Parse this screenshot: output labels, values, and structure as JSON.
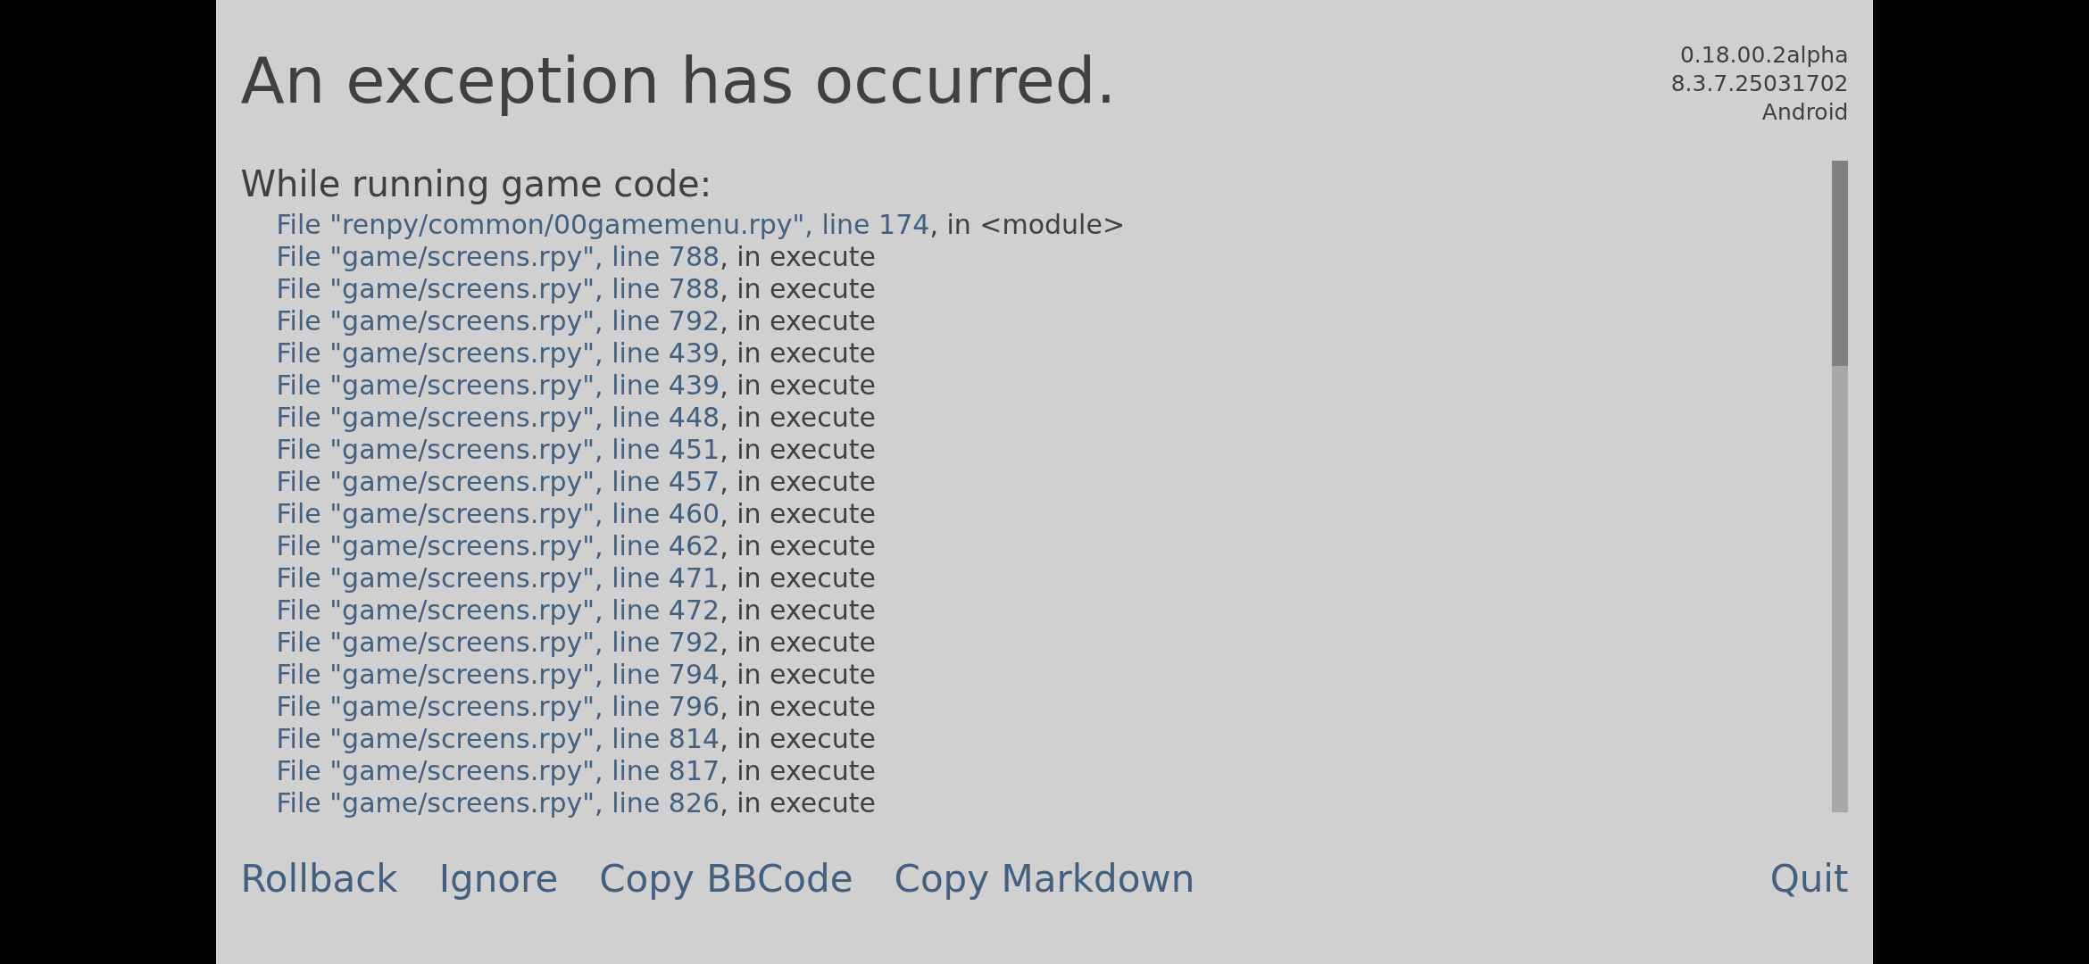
{
  "title": "An exception has occurred.",
  "version_info": [
    "0.18.00.2alpha",
    "8.3.7.25031702",
    "Android"
  ],
  "heading": "While running game code:",
  "traceback": [
    {
      "location": "File \"renpy/common/00gamemenu.rpy\", line 174",
      "rest": ", in <module>"
    },
    {
      "location": "File \"game/screens.rpy\", line 788",
      "rest": ", in execute"
    },
    {
      "location": "File \"game/screens.rpy\", line 788",
      "rest": ", in execute"
    },
    {
      "location": "File \"game/screens.rpy\", line 792",
      "rest": ", in execute"
    },
    {
      "location": "File \"game/screens.rpy\", line 439",
      "rest": ", in execute"
    },
    {
      "location": "File \"game/screens.rpy\", line 439",
      "rest": ", in execute"
    },
    {
      "location": "File \"game/screens.rpy\", line 448",
      "rest": ", in execute"
    },
    {
      "location": "File \"game/screens.rpy\", line 451",
      "rest": ", in execute"
    },
    {
      "location": "File \"game/screens.rpy\", line 457",
      "rest": ", in execute"
    },
    {
      "location": "File \"game/screens.rpy\", line 460",
      "rest": ", in execute"
    },
    {
      "location": "File \"game/screens.rpy\", line 462",
      "rest": ", in execute"
    },
    {
      "location": "File \"game/screens.rpy\", line 471",
      "rest": ", in execute"
    },
    {
      "location": "File \"game/screens.rpy\", line 472",
      "rest": ", in execute"
    },
    {
      "location": "File \"game/screens.rpy\", line 792",
      "rest": ", in execute"
    },
    {
      "location": "File \"game/screens.rpy\", line 794",
      "rest": ", in execute"
    },
    {
      "location": "File \"game/screens.rpy\", line 796",
      "rest": ", in execute"
    },
    {
      "location": "File \"game/screens.rpy\", line 814",
      "rest": ", in execute"
    },
    {
      "location": "File \"game/screens.rpy\", line 817",
      "rest": ", in execute"
    },
    {
      "location": "File \"game/screens.rpy\", line 826",
      "rest": ", in execute"
    }
  ],
  "actions": [
    "Rollback",
    "Ignore",
    "Copy BBCode",
    "Copy Markdown"
  ],
  "quit": "Quit"
}
